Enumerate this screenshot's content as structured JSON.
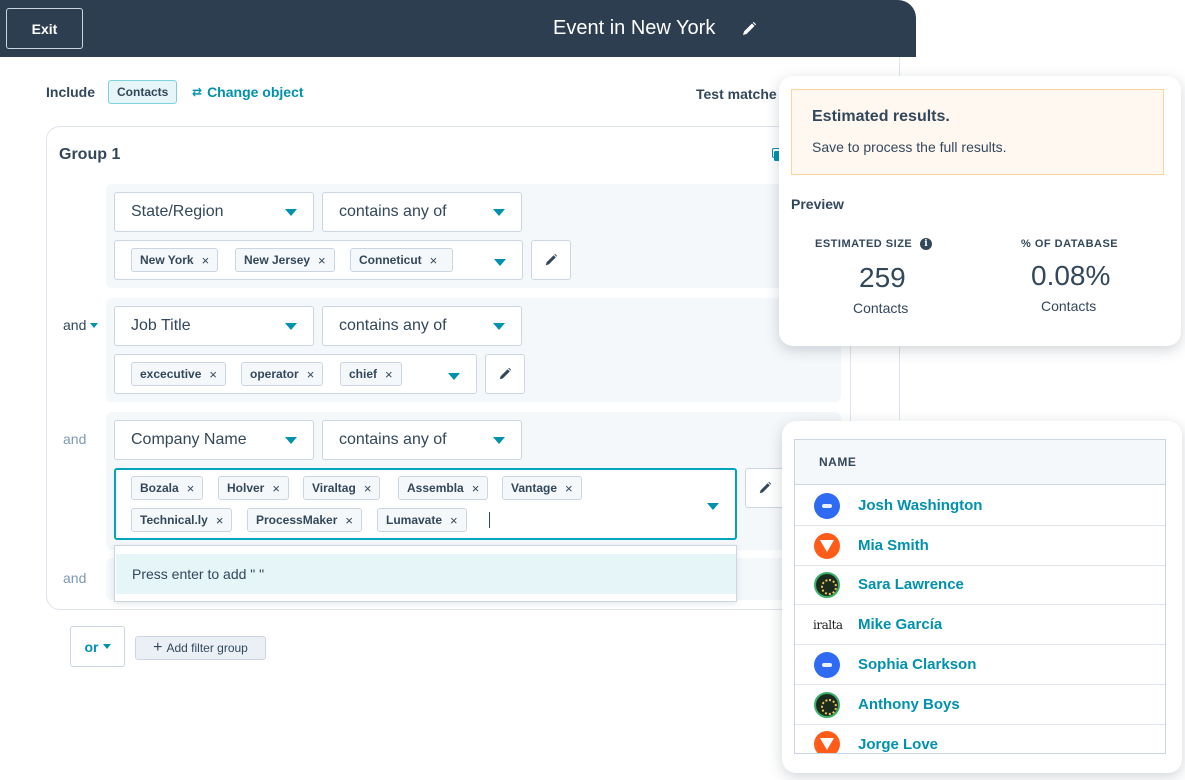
{
  "header": {
    "exit_label": "Exit",
    "title": "Event in New York",
    "edit_icon": "pencil-icon"
  },
  "include": {
    "label": "Include",
    "object": "Contacts",
    "change_label": "Change object",
    "test_label": "Test matche"
  },
  "group": {
    "title": "Group 1",
    "filters": [
      {
        "property": "State/Region",
        "operator": "contains any of",
        "values": [
          "New York",
          "New Jersey",
          "Conneticut"
        ]
      },
      {
        "connector": "and",
        "property": "Job Title",
        "operator": "contains any of",
        "values": [
          "excecutive",
          "operator",
          "chief"
        ]
      },
      {
        "connector": "and",
        "property": "Company Name",
        "operator": "contains any of",
        "values": [
          "Bozala",
          "Holver",
          "Viraltag",
          "Assembla",
          "Vantage",
          "Technical.ly",
          "ProcessMaker",
          "Lumavate"
        ]
      },
      {
        "connector": "and"
      }
    ],
    "dropdown_hint": "Press enter to add \" \""
  },
  "actions": {
    "or_label": "or",
    "add_group_label": "Add filter group"
  },
  "estimate": {
    "title": "Estimated results.",
    "subtitle": "Save to process the full results.",
    "preview_label": "Preview",
    "size_label": "ESTIMATED SIZE",
    "size_value": "259",
    "size_unit": "Contacts",
    "pct_label": "% OF DATABASE",
    "pct_value": "0.08%",
    "pct_unit": "Contacts"
  },
  "names": {
    "header": "NAME",
    "rows": [
      {
        "name": "Josh Washington",
        "logo": "blue-circle-logo"
      },
      {
        "name": "Mia Smith",
        "logo": "orange-v-logo"
      },
      {
        "name": "Sara Lawrence",
        "logo": "zala-badge-logo"
      },
      {
        "name": "Mike García",
        "logo": "iralta-wordmark-logo",
        "logo_text": "iralta"
      },
      {
        "name": "Sophia Clarkson",
        "logo": "blue-circle-logo"
      },
      {
        "name": "Anthony Boys",
        "logo": "zala-badge-logo"
      },
      {
        "name": "Jorge Love",
        "logo": "orange-v-logo"
      }
    ]
  }
}
